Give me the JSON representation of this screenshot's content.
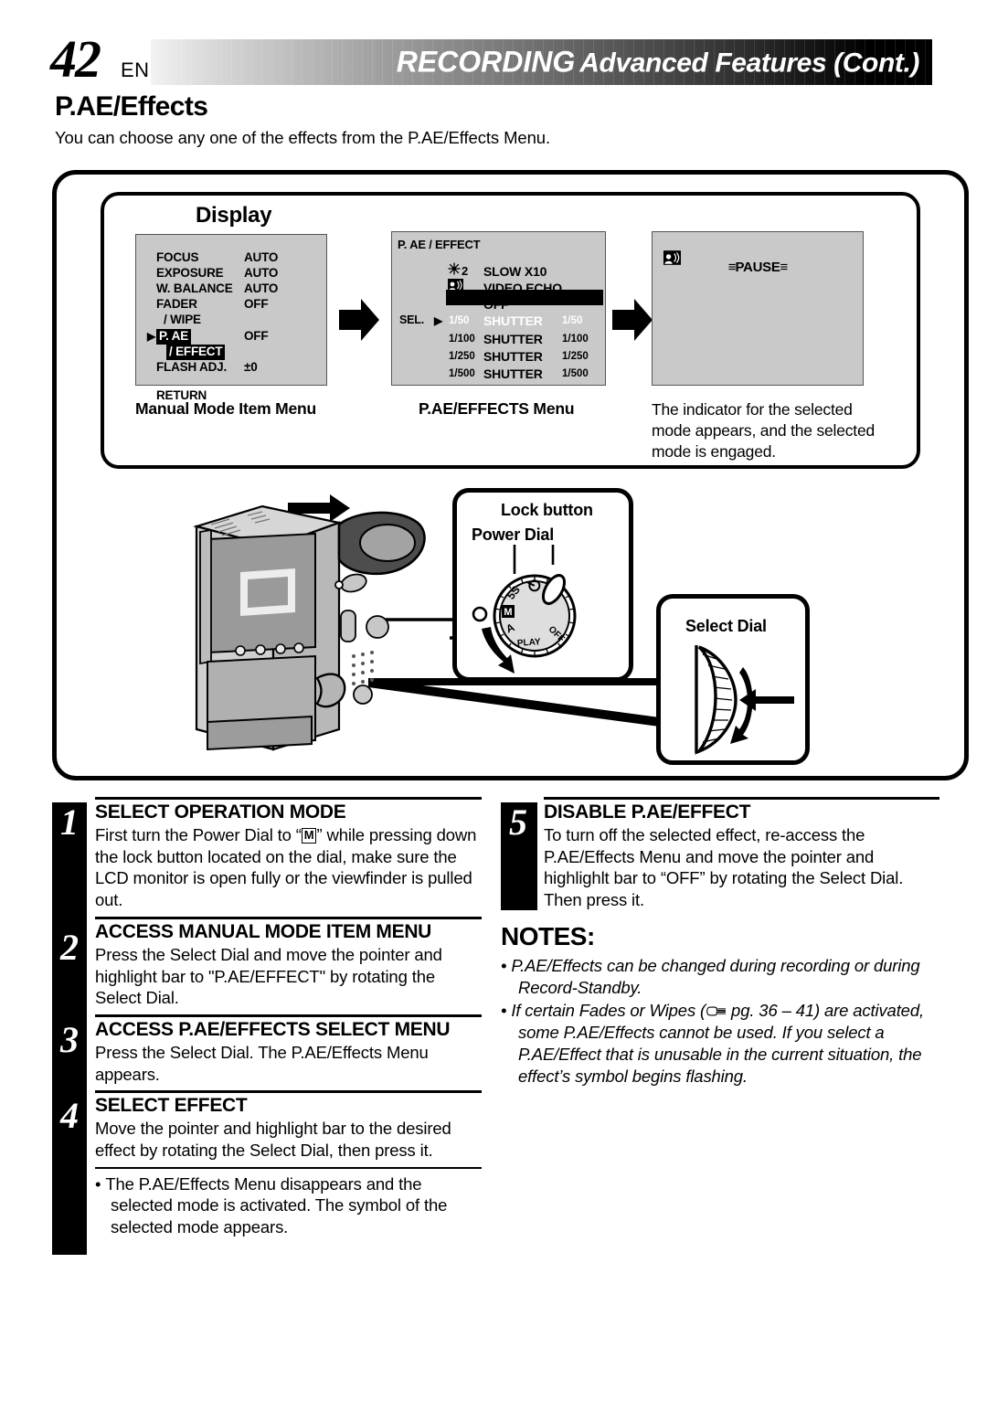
{
  "header": {
    "page_number": "42",
    "language_code": "EN",
    "title_emphasis": "RECORDING",
    "title_rest": "Advanced Features (Cont.)"
  },
  "section": {
    "title": "P.AE/Effects",
    "intro": "You can choose any one of the effects from the P.AE/Effects Menu."
  },
  "display_panel": {
    "label": "Display",
    "manual_menu": {
      "rows": [
        {
          "name": "FOCUS",
          "value": "AUTO"
        },
        {
          "name": "EXPOSURE",
          "value": "AUTO"
        },
        {
          "name": "W. BALANCE",
          "value": "AUTO"
        },
        {
          "name": "FADER",
          "value": "OFF"
        },
        {
          "name": "/ WIPE",
          "value": ""
        },
        {
          "name": "P. AE",
          "value": "OFF"
        },
        {
          "name": "/ EFFECT",
          "value": ""
        },
        {
          "name": "FLASH ADJ.",
          "value": "±0"
        },
        {
          "name": "RETURN",
          "value": ""
        }
      ],
      "pointer_glyph": "▶",
      "caption": "Manual Mode Item Menu"
    },
    "pae_menu": {
      "title": "P. AE / EFFECT",
      "sel_label": "SEL.",
      "sel_glyph": "▶",
      "rows": [
        {
          "icon": "sun-2-icon",
          "icon_text": "2",
          "label": "SLOW X10",
          "speed": ""
        },
        {
          "icon": "video-echo-icon",
          "icon_text": "",
          "label": "VIDEO ECHO",
          "speed": ""
        },
        {
          "icon": "",
          "icon_text": "",
          "label": "OFF",
          "speed": ""
        },
        {
          "icon": "",
          "icon_text": "1/50",
          "label": "SHUTTER",
          "speed": "1/50"
        },
        {
          "icon": "",
          "icon_text": "1/100",
          "label": "SHUTTER",
          "speed": "1/100"
        },
        {
          "icon": "",
          "icon_text": "1/250",
          "label": "SHUTTER",
          "speed": "1/250"
        },
        {
          "icon": "",
          "icon_text": "1/500",
          "label": "SHUTTER",
          "speed": "1/500"
        }
      ],
      "highlighted_row_index": 3,
      "caption": "P.AE/EFFECTS Menu"
    },
    "indicator_screen": {
      "indicator_icon": "video-echo-icon",
      "status_text": "PAUSE",
      "caption": "The indicator for the selected mode appears, and the selected mode is engaged."
    }
  },
  "illustration": {
    "lock_button_label": "Lock button",
    "power_dial_label": "Power Dial",
    "select_dial_label": "Select Dial",
    "dial_positions": [
      "PLAY",
      "A",
      "M",
      "5S",
      "OFF"
    ]
  },
  "steps": [
    {
      "number": "1",
      "heading": "SELECT OPERATION MODE",
      "text_before": "First turn the Power Dial to “",
      "boxed": "M",
      "text_after": "” while pressing down the lock button located on the dial, make sure the LCD monitor is open fully or the viewfinder is pulled out."
    },
    {
      "number": "2",
      "heading": "ACCESS MANUAL MODE ITEM MENU",
      "text": "Press the Select Dial and move the pointer and highlight bar to \"P.AE/EFFECT\" by rotating the Select Dial."
    },
    {
      "number": "3",
      "heading": "ACCESS P.AE/EFFECTS SELECT MENU",
      "text": "Press the Select Dial. The P.AE/Effects Menu appears."
    },
    {
      "number": "4",
      "heading": "SELECT EFFECT",
      "text": "Move the pointer and highlight bar to the desired effect by rotating the Select Dial, then press it."
    }
  ],
  "left_bullet": "The P.AE/Effects Menu disappears and the selected mode is activated. The symbol of the selected mode appears.",
  "step5": {
    "number": "5",
    "heading": "DISABLE P.AE/EFFECT",
    "text": "To turn off the selected effect, re-access the P.AE/Effects Menu and move the pointer and highlighlt bar to “OFF” by rotating the Select Dial. Then press it."
  },
  "notes": {
    "title": "NOTES:",
    "items": [
      {
        "text_before": "P.AE/Effects can be changed during recording or during Record-Standby.",
        "has_icon": false,
        "text_after": ""
      },
      {
        "text_before": "If certain Fades or Wipes (",
        "has_icon": true,
        "text_after": " pg. 36 – 41) are activated, some P.AE/Effects cannot be used. If you select a P.AE/Effect that is unusable in the current situation, the effect’s symbol begins flashing."
      }
    ]
  },
  "colors": {
    "screen_gray": "#c9c9c9",
    "ink": "#000000",
    "paper": "#ffffff"
  }
}
